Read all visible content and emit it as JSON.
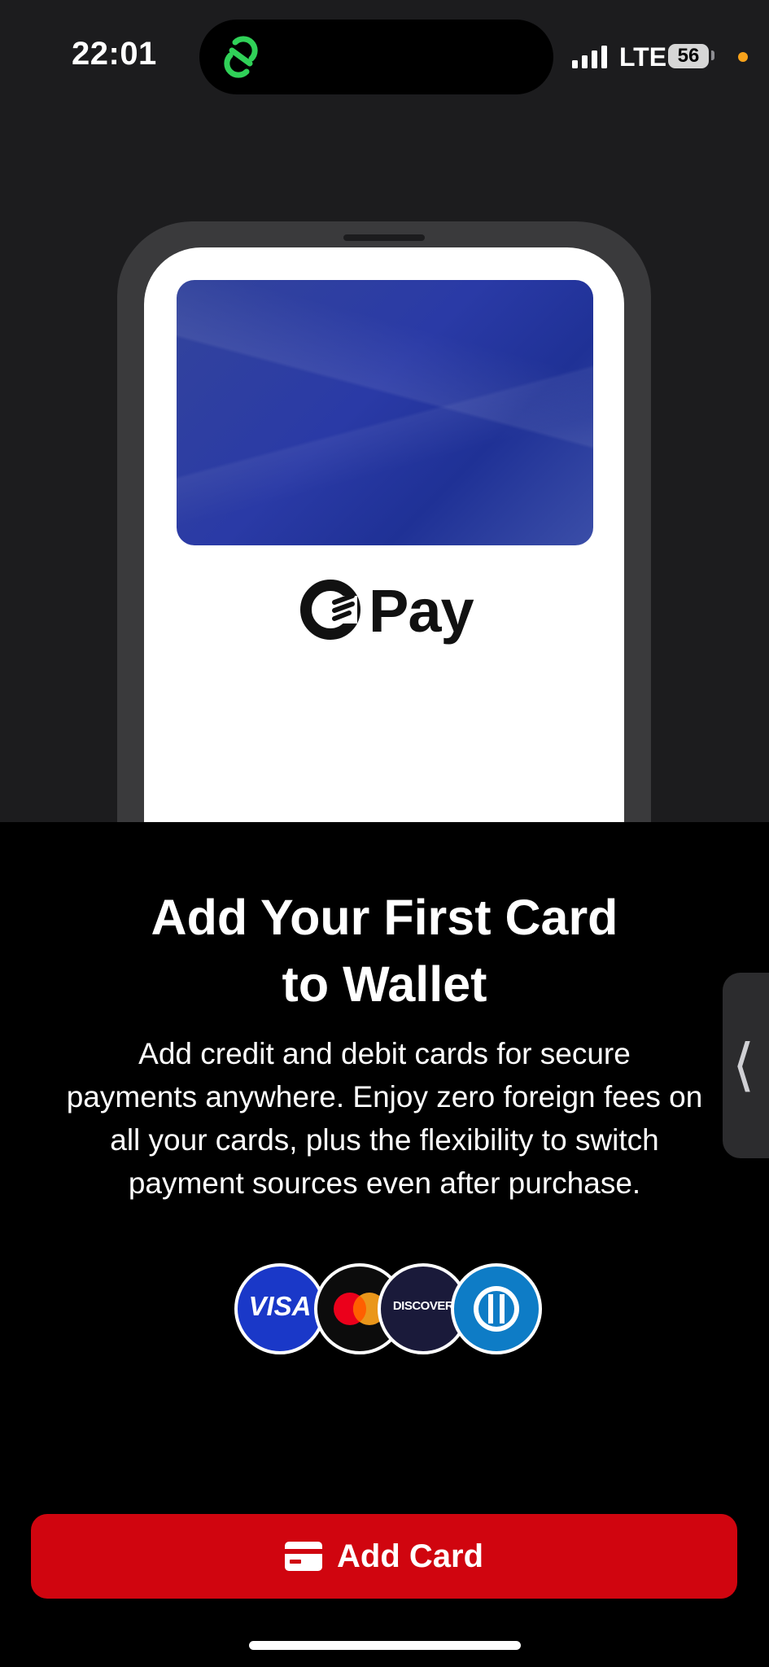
{
  "status_bar": {
    "time": "22:01",
    "network": "LTE",
    "battery": "56"
  },
  "illustration": {
    "logo_text": "Pay"
  },
  "main": {
    "title_line1": "Add Your First Card",
    "title_line2": "to Wallet",
    "desc_lines": [
      "Add credit and debit cards for secure",
      "payments anywhere. Enjoy zero foreign fees on",
      "all your cards, plus the flexibility to switch",
      "payment sources even after purchase."
    ]
  },
  "brands": {
    "visa": "VISA",
    "discover": "DISCOVER"
  },
  "side_handle": {
    "icon": "chevron-left-icon"
  },
  "button": {
    "label": "Add Card",
    "icon": "credit-card-icon",
    "color": "#d0050f"
  }
}
